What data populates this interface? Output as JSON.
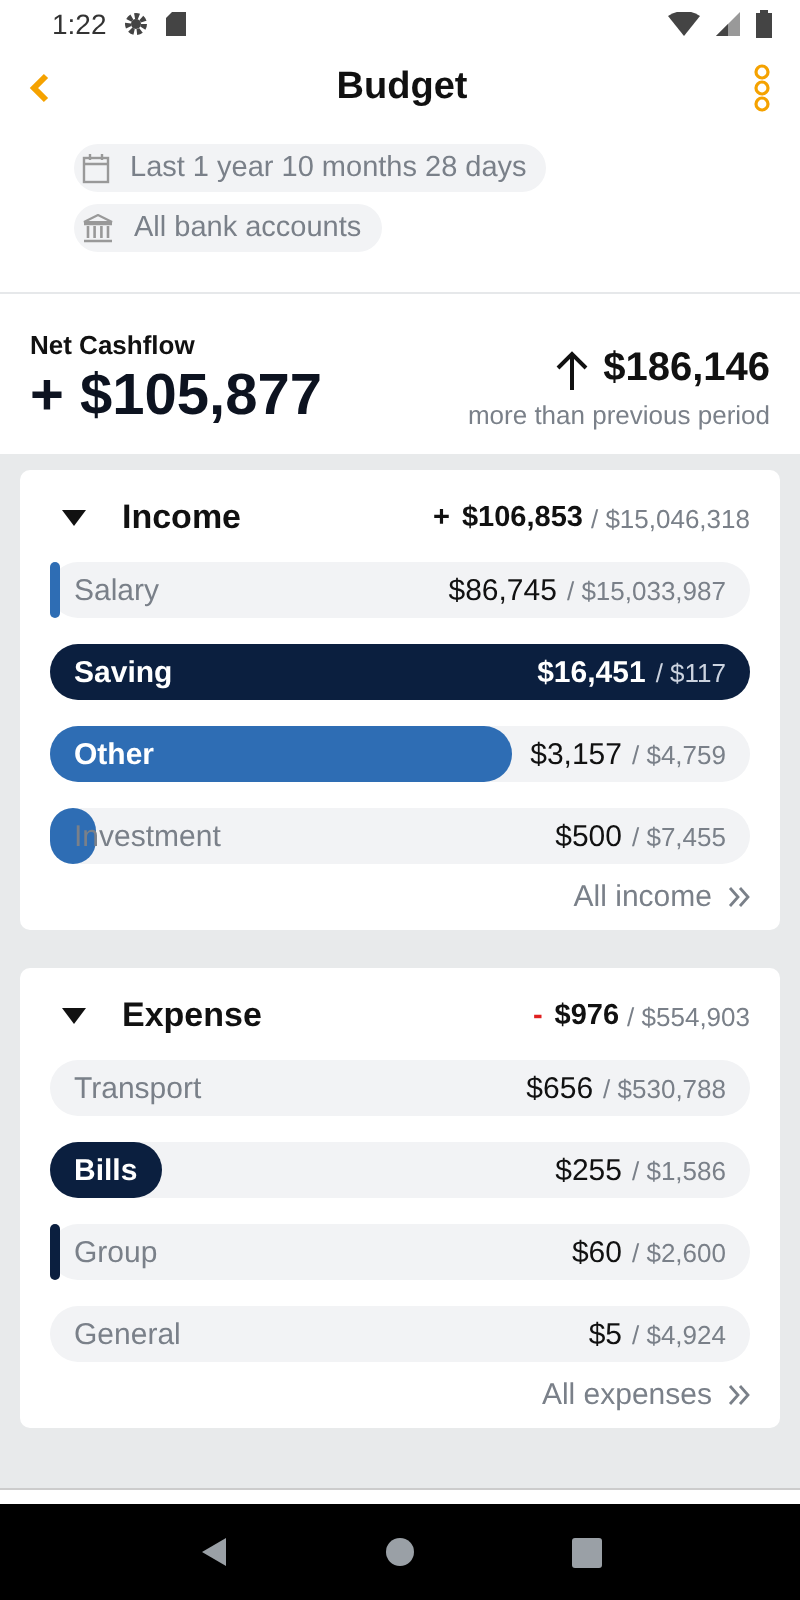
{
  "status_bar": {
    "time": "1:22"
  },
  "header": {
    "title": "Budget"
  },
  "filters": [
    {
      "kind": "period",
      "label": "Last 1 year 10 months 28 days"
    },
    {
      "kind": "accounts",
      "label": "All bank accounts"
    }
  ],
  "net_cashflow": {
    "label": "Net Cashflow",
    "value": "+ $105,877",
    "change": "$186,146",
    "change_note": "more than previous period"
  },
  "sections": [
    {
      "kind": "income",
      "title": "Income",
      "expanded": true,
      "sign": "+",
      "amount": "$106,853",
      "total": "/ $15,046,318",
      "link": "All income",
      "rows": [
        {
          "label": "Salary",
          "amount": "$86,745",
          "total": "/ $15,033,987",
          "level": 0.006,
          "color": "#2e6db4"
        },
        {
          "label": "Saving",
          "amount": "$16,451",
          "total": "/ $117",
          "level": 1,
          "color": "#0b1f3f"
        },
        {
          "label": "Other",
          "amount": "$3,157",
          "total": "/ $4,759",
          "level": 0.66,
          "color": "#2e6db4"
        },
        {
          "label": "Investment",
          "amount": "$500",
          "total": "/ $7,455",
          "level": 0.067,
          "color": "#2e6db4"
        }
      ]
    },
    {
      "kind": "expense",
      "title": "Expense",
      "expanded": true,
      "sign": "-",
      "amount": "$976",
      "total": "/ $554,903",
      "link": "All expenses",
      "rows": [
        {
          "label": "Transport",
          "amount": "$656",
          "total": "/ $530,788"
        },
        {
          "label": "Bills",
          "amount": "$255",
          "total": "/ $1,586",
          "level": 0.16,
          "color": "#0b1f3f"
        },
        {
          "label": "Group",
          "amount": "$60",
          "total": "/ $2,600",
          "level": 0.012,
          "color": "#0b1f3f"
        },
        {
          "label": "General",
          "amount": "$5",
          "total": "/ $4,924"
        }
      ]
    }
  ]
}
